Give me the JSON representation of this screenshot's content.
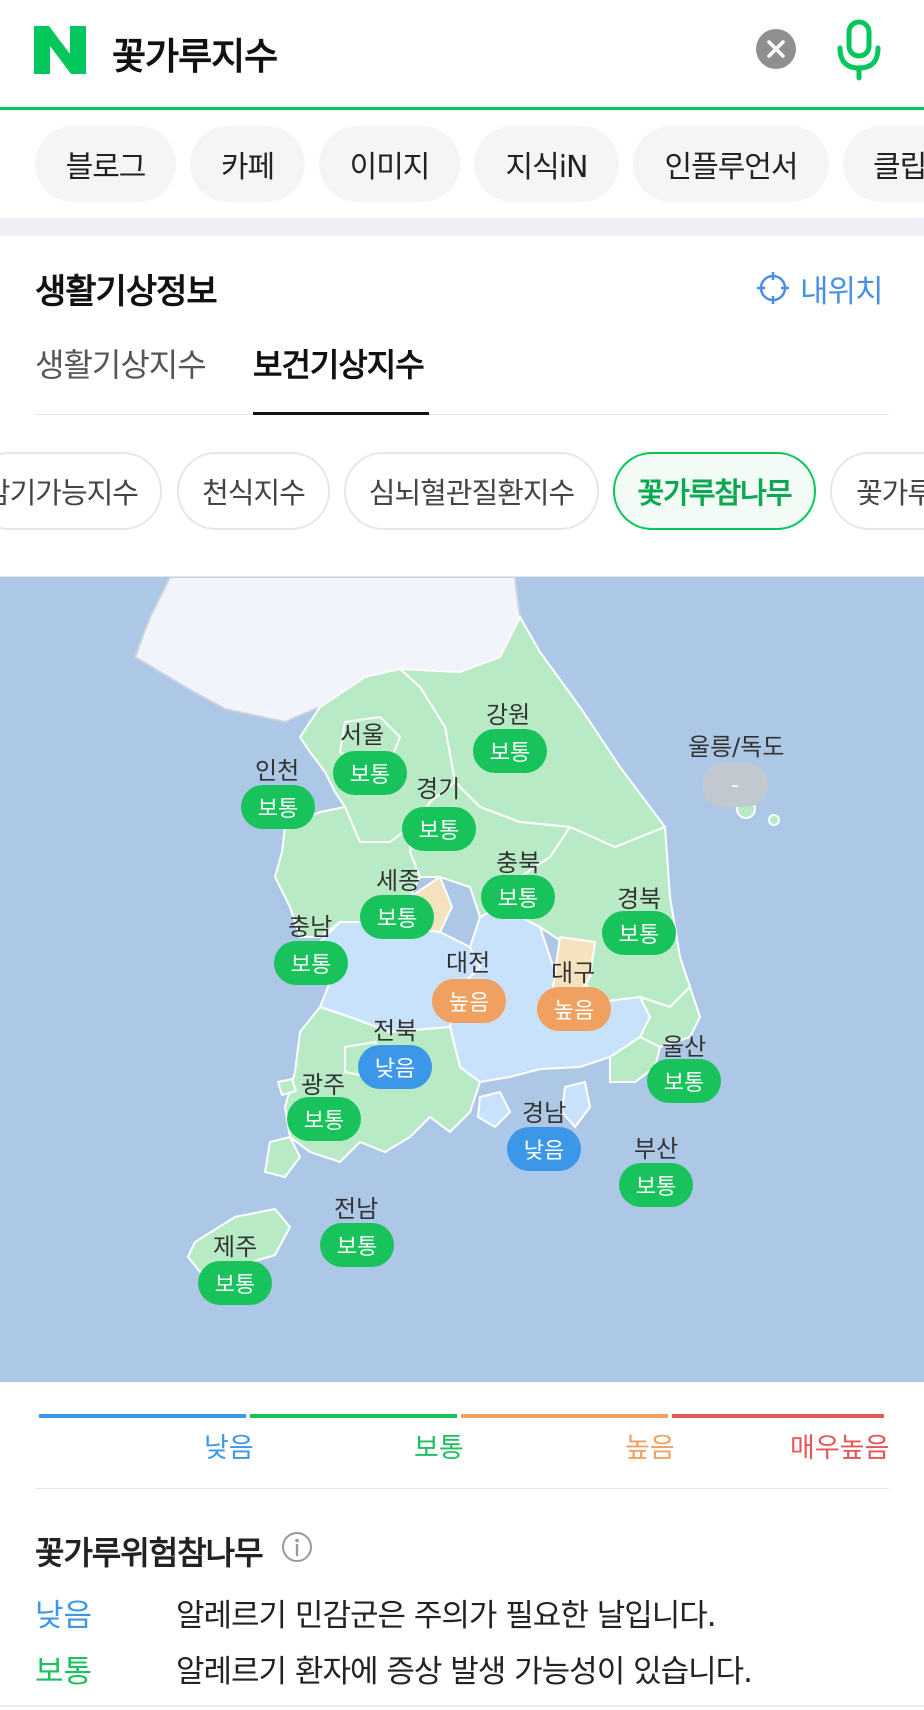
{
  "search": {
    "query": "꽃가루지수"
  },
  "categories": [
    {
      "label": "블로그"
    },
    {
      "label": "카페"
    },
    {
      "label": "이미지"
    },
    {
      "label": "지식iN"
    },
    {
      "label": "인플루언서"
    },
    {
      "label": "클립"
    }
  ],
  "section": {
    "title": "생활기상정보",
    "my_location": "내위치"
  },
  "tabs": [
    {
      "label": "생활기상지수"
    },
    {
      "label": "보건기상지수"
    }
  ],
  "index_chips": [
    {
      "label": "감기가능지수"
    },
    {
      "label": "천식지수"
    },
    {
      "label": "심뇌혈관질환지수"
    },
    {
      "label": "꽃가루참나무"
    },
    {
      "label": "꽃가루"
    }
  ],
  "map": {
    "regions": [
      {
        "name": "서울",
        "level": "보통"
      },
      {
        "name": "강원",
        "level": "보통"
      },
      {
        "name": "울릉/독도",
        "level": "-"
      },
      {
        "name": "인천",
        "level": "보통"
      },
      {
        "name": "경기",
        "level": "보통"
      },
      {
        "name": "충북",
        "level": "보통"
      },
      {
        "name": "세종",
        "level": "보통"
      },
      {
        "name": "경북",
        "level": "보통"
      },
      {
        "name": "충남",
        "level": "보통"
      },
      {
        "name": "대전",
        "level": "높음"
      },
      {
        "name": "대구",
        "level": "높음"
      },
      {
        "name": "전북",
        "level": "낮음"
      },
      {
        "name": "울산",
        "level": "보통"
      },
      {
        "name": "광주",
        "level": "보통"
      },
      {
        "name": "경남",
        "level": "낮음"
      },
      {
        "name": "부산",
        "level": "보통"
      },
      {
        "name": "전남",
        "level": "보통"
      },
      {
        "name": "제주",
        "level": "보통"
      }
    ]
  },
  "legend": [
    {
      "label": "낮음",
      "color": "#3d97e8"
    },
    {
      "label": "보통",
      "color": "#19c35b"
    },
    {
      "label": "높음",
      "color": "#f0a060"
    },
    {
      "label": "매우높음",
      "color": "#e45757"
    }
  ],
  "colors": {
    "low": "#3d97e8",
    "normal": "#19c35b",
    "high": "#f0a060",
    "none": "#c2c8cf",
    "brand": "#03c75a"
  },
  "risk": {
    "title": "꽃가루위험참나무",
    "rows": [
      {
        "level": "낮음",
        "desc": "알레르기 민감군은 주의가 필요한 날입니다."
      },
      {
        "level": "보통",
        "desc": "알레르기 환자에 증상 발생 가능성이 있습니다."
      }
    ]
  }
}
